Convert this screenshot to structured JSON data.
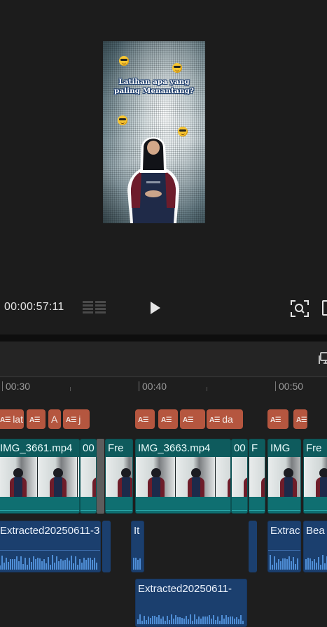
{
  "preview": {
    "caption_line1": "Latihan apa yang",
    "caption_line2": "paling Menantang?"
  },
  "player": {
    "timecode": "00:00:57:11"
  },
  "ruler": {
    "labels": [
      "00:30",
      "00:40",
      "00:50"
    ]
  },
  "text_track": {
    "icon_glyph": "A☰",
    "clips": [
      "lat",
      "",
      "A",
      "j",
      "",
      "",
      "",
      "da",
      "",
      ""
    ]
  },
  "video_track": {
    "clips": [
      "IMG_3661.mp4",
      "00",
      "Fre",
      "IMG_3663.mp4",
      "00",
      "F",
      "IMG",
      "Fre"
    ]
  },
  "audio_track_1": {
    "clips": [
      "Extracted20250611-3",
      "It",
      "Extrac",
      "Bea"
    ]
  },
  "audio_track_2": {
    "clips": [
      "Extracted20250611-"
    ]
  },
  "colors": {
    "text_clip": "#b5563f",
    "video_clip": "#0f6466",
    "audio_clip": "#1b3f6e",
    "background": "#1a1a1a"
  }
}
